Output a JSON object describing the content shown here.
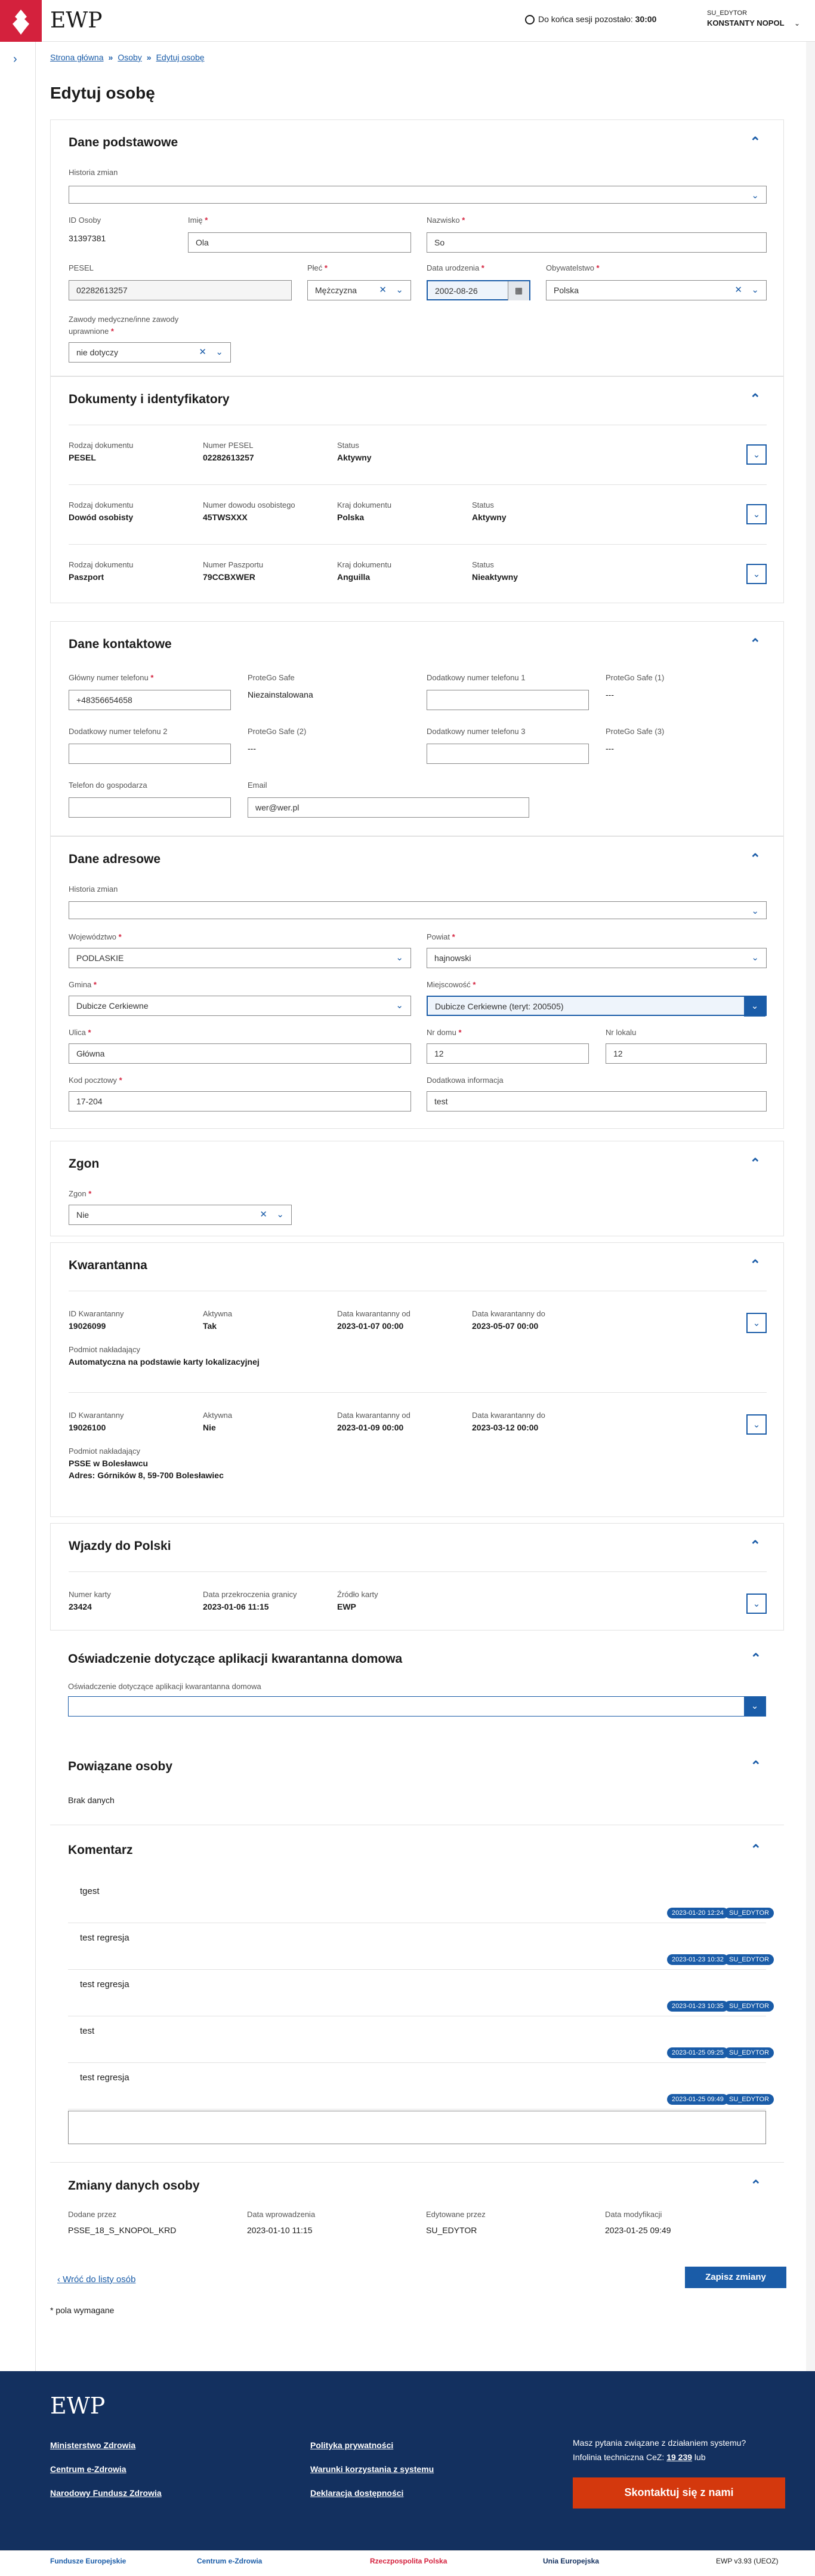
{
  "header": {
    "brand": "EWP",
    "session_label": "Do końca sesji pozostało:",
    "session_time": "30:00",
    "role": "SU_EDYTOR",
    "user": "KONSTANTY NOPOL"
  },
  "breadcrumb": [
    "Strona główna",
    "Osoby",
    "Edytuj osobę"
  ],
  "title": "Edytuj osobę",
  "basic": {
    "title": "Dane podstawowe",
    "history_label": "Historia zmian",
    "id_label": "ID Osoby",
    "id": "31397381",
    "name_label": "Imię",
    "name": "Ola",
    "surname_label": "Nazwisko",
    "surname": "So",
    "pesel_label": "PESEL",
    "pesel": "02282613257",
    "sex_label": "Płeć",
    "sex": "Mężczyzna",
    "dob_label": "Data urodzenia",
    "dob": "2002-08-26",
    "citizen_label": "Obywatelstwo",
    "citizen": "Polska",
    "prof_label": "Zawody medyczne/inne zawody uprawnione",
    "prof": "nie dotyczy"
  },
  "docs": {
    "title": "Dokumenty i identyfikatory",
    "items": [
      {
        "cols": [
          [
            "Rodzaj dokumentu",
            "PESEL"
          ],
          [
            "Numer PESEL",
            "02282613257"
          ],
          [
            "Status",
            "Aktywny"
          ]
        ]
      },
      {
        "cols": [
          [
            "Rodzaj dokumentu",
            "Dowód osobisty"
          ],
          [
            "Numer dowodu osobistego",
            "45TWSXXX"
          ],
          [
            "Kraj dokumentu",
            "Polska"
          ],
          [
            "Status",
            "Aktywny"
          ]
        ]
      },
      {
        "cols": [
          [
            "Rodzaj dokumentu",
            "Paszport"
          ],
          [
            "Numer Paszportu",
            "79CCBXWER"
          ],
          [
            "Kraj dokumentu",
            "Anguilla"
          ],
          [
            "Status",
            "Nieaktywny"
          ]
        ]
      }
    ]
  },
  "contact": {
    "title": "Dane kontaktowe",
    "main_phone_label": "Główny numer telefonu",
    "main_phone": "+48356654658",
    "pg_label": "ProteGo Safe",
    "pg": "Niezainstalowana",
    "add1_label": "Dodatkowy numer telefonu 1",
    "pg1_label": "ProteGo Safe (1)",
    "pg1": "---",
    "add2_label": "Dodatkowy numer telefonu 2",
    "pg2_label": "ProteGo Safe (2)",
    "pg2": "---",
    "add3_label": "Dodatkowy numer telefonu 3",
    "pg3_label": "ProteGo Safe (3)",
    "pg3": "---",
    "host_label": "Telefon do gospodarza",
    "email_label": "Email",
    "email": "wer@wer.pl"
  },
  "address": {
    "title": "Dane adresowe",
    "history_label": "Historia zmian",
    "voiv_label": "Województwo",
    "voiv": "PODLASKIE",
    "pow_label": "Powiat",
    "pow": "hajnowski",
    "gmina_label": "Gmina",
    "gmina": "Dubicze Cerkiewne",
    "miejsc_label": "Miejscowość",
    "miejsc": "Dubicze Cerkiewne (teryt: 200505)",
    "street_label": "Ulica",
    "street": "Główna",
    "house_label": "Nr domu",
    "house": "12",
    "flat_label": "Nr lokalu",
    "flat": "12",
    "zip_label": "Kod pocztowy",
    "zip": "17-204",
    "info_label": "Dodatkowa informacja",
    "info": "test"
  },
  "death": {
    "title": "Zgon",
    "label": "Zgon",
    "value": "Nie"
  },
  "quarantine": {
    "title": "Kwarantanna",
    "items": [
      {
        "cols": [
          [
            "ID Kwarantanny",
            "19026099"
          ],
          [
            "Aktywna",
            "Tak"
          ],
          [
            "Data kwarantanny od",
            "2023-01-07 00:00"
          ],
          [
            "Data kwarantanny do",
            "2023-05-07 00:00"
          ]
        ],
        "by_label": "Podmiot nakładający",
        "by": "Automatyczna na podstawie karty lokalizacyjnej",
        "addr": ""
      },
      {
        "cols": [
          [
            "ID Kwarantanny",
            "19026100"
          ],
          [
            "Aktywna",
            "Nie"
          ],
          [
            "Data kwarantanny od",
            "2023-01-09 00:00"
          ],
          [
            "Data kwarantanny do",
            "2023-03-12 00:00"
          ]
        ],
        "by_label": "Podmiot nakładający",
        "by": "PSSE w Bolesławcu",
        "addr": "Adres: Górników 8, 59-700 Bolesławiec"
      }
    ]
  },
  "entries": {
    "title": "Wjazdy do Polski",
    "cols": [
      [
        "Numer karty",
        "23424"
      ],
      [
        "Data przekroczenia granicy",
        "2023-01-06 11:15"
      ],
      [
        "Źródło karty",
        "EWP"
      ]
    ]
  },
  "declaration": {
    "title": "Oświadczenie dotyczące aplikacji kwarantanna domowa",
    "label": "Oświadczenie dotyczące aplikacji kwarantanna domowa"
  },
  "related": {
    "title": "Powiązane osoby",
    "empty": "Brak danych"
  },
  "comments": {
    "title": "Komentarz",
    "items": [
      {
        "text": "tgest",
        "date": "2023-01-20 12:24",
        "author": "SU_EDYTOR"
      },
      {
        "text": "test regresja",
        "date": "2023-01-23 10:32",
        "author": "SU_EDYTOR"
      },
      {
        "text": "test regresja",
        "date": "2023-01-23 10:35",
        "author": "SU_EDYTOR"
      },
      {
        "text": "test",
        "date": "2023-01-25 09:25",
        "author": "SU_EDYTOR"
      },
      {
        "text": "test regresja",
        "date": "2023-01-25 09:49",
        "author": "SU_EDYTOR"
      }
    ]
  },
  "changes": {
    "title": "Zmiany danych osoby",
    "cols": [
      [
        "Dodane przez",
        "PSSE_18_S_KNOPOL_KRD"
      ],
      [
        "Data wprowadzenia",
        "2023-01-10 11:15"
      ],
      [
        "Edytowane przez",
        "SU_EDYTOR"
      ],
      [
        "Data modyfikacji",
        "2023-01-25 09:49"
      ]
    ]
  },
  "actions": {
    "back": "Wróć do listy osób",
    "save": "Zapisz zmiany",
    "required": "* pola wymagane"
  },
  "footer": {
    "brand": "EWP",
    "links": [
      "Ministerstwo Zdrowia",
      "Centrum e-Zdrowia",
      "Narodowy Fundusz Zdrowia",
      "Polityka prywatności",
      "Warunki korzystania z systemu",
      "Deklaracja dostępności"
    ],
    "question": "Masz pytania związane z działaniem systemu?",
    "hotline": "Infolinia techniczna CeZ:",
    "hotline_num": "19 239",
    "hotline_tail": "lub",
    "cta": "Skontaktuj się z nami"
  },
  "logos": [
    "Fundusze Europejskie",
    "Centrum e-Zdrowia",
    "Rzeczpospolita Polska",
    "Unia Europejska",
    "EWP v3.93 (UEOZ)"
  ]
}
